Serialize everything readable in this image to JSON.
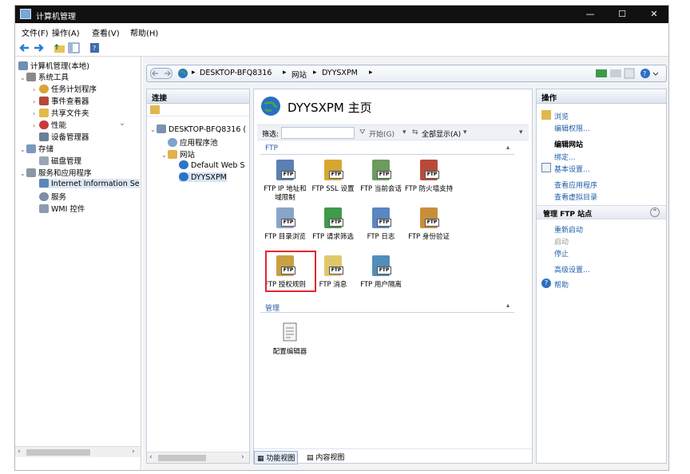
{
  "window": {
    "title": "计算机管理",
    "min": "—",
    "max": "☐",
    "close": "✕"
  },
  "menu": [
    "文件(F)",
    "操作(A)",
    "查看(V)",
    "帮助(H)"
  ],
  "tree": {
    "root": "计算机管理(本地)",
    "system_tools": "系统工具",
    "task_scheduler": "任务计划程序",
    "event_viewer": "事件查看器",
    "shared_folders": "共享文件夹",
    "performance": "性能",
    "device_manager": "设备管理器",
    "storage": "存储",
    "disk_mgmt": "磁盘管理",
    "services_apps": "服务和应用程序",
    "iis": "Internet Information Se",
    "services": "服务",
    "wmi": "WMI 控件"
  },
  "address": {
    "parts": [
      "DESKTOP-BFQ8316",
      "网站",
      "DYYSXPM"
    ],
    "sep": "▸"
  },
  "connections": {
    "title": "连接",
    "server": "DESKTOP-BFQ8316 (",
    "app_pools": "应用程序池",
    "sites": "网站",
    "default_site": "Default Web S",
    "site": "DYYSXPM"
  },
  "center": {
    "heading": "DYYSXPM 主页",
    "filter_label": "筛选:",
    "start_label": "开始(G)",
    "show_all_label": "全部显示(A)",
    "ftp_section": "FTP",
    "mgmt_section": "管理",
    "features": [
      {
        "label": "FTP IP 地址和域限制",
        "color": "#5b7fb5"
      },
      {
        "label": "FTP SSL 设置",
        "color": "#d8a630"
      },
      {
        "label": "FTP 当前会话",
        "color": "#6c9c5c"
      },
      {
        "label": "FTP 防火墙支持",
        "color": "#b84a3a"
      },
      {
        "label": "FTP 目录浏览",
        "color": "#8aa4c8"
      },
      {
        "label": "FTP 请求筛选",
        "color": "#3f9a4a"
      },
      {
        "label": "FTP 日志",
        "color": "#5a86c2"
      },
      {
        "label": "FTP 身份验证",
        "color": "#c98e3a"
      },
      {
        "label": "FTP 授权规则",
        "color": "#c9a042"
      },
      {
        "label": "FTP 消息",
        "color": "#e0c86a"
      },
      {
        "label": "FTP 用户隔离",
        "color": "#4f8fb9"
      }
    ],
    "ftp_tag": "FTP",
    "config_editor": "配置编辑器",
    "highlight_color": "#e3262c",
    "tab_features": "功能视图",
    "tab_content": "内容视图"
  },
  "actions": {
    "title": "操作",
    "explore": "浏览",
    "edit_perms": "编辑权限...",
    "edit_site_header": "编辑网站",
    "bindings": "绑定...",
    "basic_settings": "基本设置...",
    "view_apps": "查看应用程序",
    "view_vdirs": "查看虚拟目录",
    "manage_ftp_header": "管理 FTP 站点",
    "restart": "重新启动",
    "start": "启动",
    "stop": "停止",
    "advanced": "高级设置...",
    "help": "帮助"
  }
}
